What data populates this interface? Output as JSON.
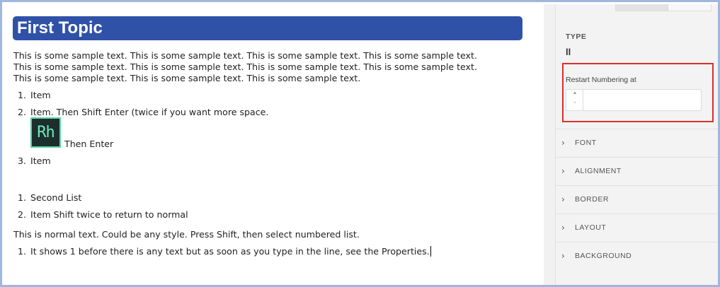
{
  "editor": {
    "heading": "First Topic",
    "paragraph_lines": [
      "This is some sample text. This is some sample text. This is some sample text. This is some sample text.",
      "This is some sample text. This is some sample text. This is some sample text. This is some sample text.",
      "This is some sample text. This is some sample text. This is some sample text."
    ],
    "list1": [
      {
        "num": "1.",
        "text": "Item"
      },
      {
        "num": "2.",
        "text": "Item. Then Shift Enter (twice if you want more space."
      },
      {
        "num": "3.",
        "text": "Item"
      }
    ],
    "logo_text": "Rh",
    "then_enter": "Then Enter",
    "list2": [
      {
        "num": "1.",
        "text": "Second List"
      },
      {
        "num": "2.",
        "text": "Item Shift twice to return to normal"
      }
    ],
    "normal_text": "This is normal text. Could be any style. Press Shift, then select numbered list.",
    "list3": [
      {
        "num": "1.",
        "text": "It shows 1 before there is any text but as soon as you type in the line, see the Properties."
      }
    ]
  },
  "panel": {
    "type_label": "TYPE",
    "type_value": "ll",
    "restart_label": "Restart Numbering at",
    "restart_value": "",
    "sections": [
      "FONT",
      "ALIGNMENT",
      "BORDER",
      "LAYOUT",
      "BACKGROUND"
    ]
  },
  "colors": {
    "heading_bg": "#2f52a8",
    "highlight_border": "#d9302c",
    "frame_border": "#9db7e0",
    "logo_bg": "#1c2f2c",
    "logo_accent": "#5cd3a3"
  },
  "icons": {
    "stepper_up": "chevron-up-icon",
    "stepper_down": "chevron-down-icon",
    "section_expand": "chevron-right-icon"
  }
}
